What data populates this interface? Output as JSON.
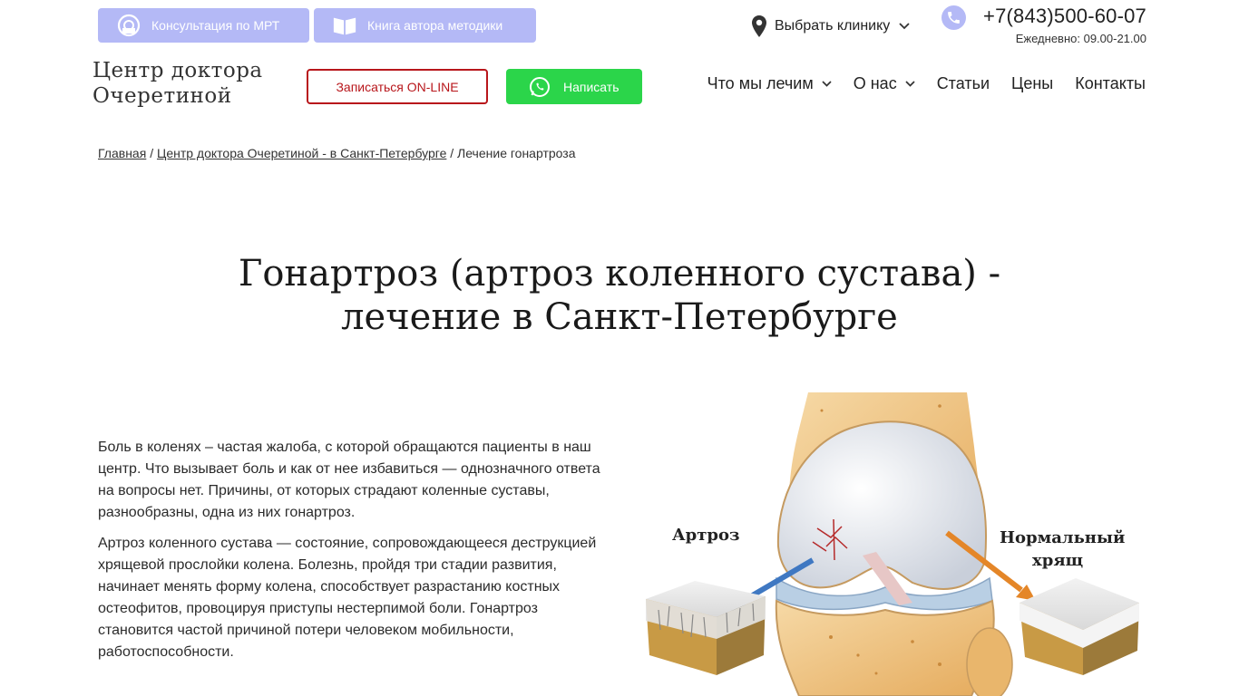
{
  "header": {
    "top_buttons": [
      {
        "label": "Консультация по МРТ",
        "icon": "mri-icon"
      },
      {
        "label": "Книга автора методики",
        "icon": "book-icon"
      }
    ],
    "clinic_select": "Выбрать клинику",
    "phone": "+7(843)500-60-07",
    "hours": "Ежедневно: 09.00-21.00",
    "logo": [
      "Центр доктора",
      "Очеретиной"
    ],
    "online_button": "Записаться ON-LINE",
    "write_button": "Написать",
    "nav": [
      "Что мы лечим",
      "О нас",
      "Статьи",
      "Цены",
      "Контакты"
    ]
  },
  "breadcrumb": {
    "home": "Главная",
    "section": "Центр доктора Очеретиной - в Санкт-Петербурге",
    "separator": "/",
    "current": "Лечение гонартроза"
  },
  "title": [
    "Гонартроз (артроз коленного сустава) -",
    "лечение в Санкт-Петербурге"
  ],
  "paragraphs": [
    "Боль в коленях – частая жалоба, с которой обращаются пациенты в наш центр. Что вызывает боль и как от нее избавиться — однозначного ответа на вопросы нет. Причины, от которых страдают коленные суставы, разнообразны, одна из них гонартроз.",
    "Артроз коленного сустава — состояние, сопровождающееся деструкцией хрящевой прослойки колена. Болезнь, пройдя три стадии развития, начинает менять форму колена, способствует разрастанию костных остеофитов, провоцируя приступы нестерпимой боли. Гонартроз становится частой причиной потери человеком мобильности, работоспособности."
  ],
  "illustration": {
    "label_left": "Артроз",
    "label_right_1": "Нормальный",
    "label_right_2": "хрящ"
  },
  "colors": {
    "accent": "#b4b9f6",
    "online_border": "#b8161b",
    "whatsapp_green": "#2bd54a"
  }
}
